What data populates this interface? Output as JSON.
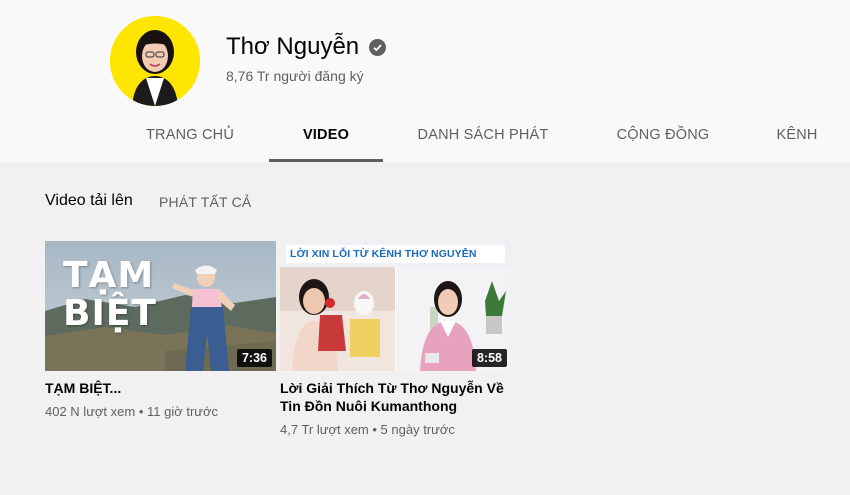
{
  "channel": {
    "name": "Thơ Nguyễn",
    "subscribers": "8,76 Tr người đăng ký"
  },
  "tabs": [
    "TRANG CHỦ",
    "VIDEO",
    "DANH SÁCH PHÁT",
    "CỘNG ĐỒNG",
    "KÊNH"
  ],
  "active_tab": "VIDEO",
  "section": {
    "title": "Video tải lên",
    "play_all": "PHÁT TẤT CẢ"
  },
  "videos": [
    {
      "thumb_text_1": "TẠM",
      "thumb_text_2": "BIỆT",
      "duration": "7:36",
      "title": "TẠM BIỆT...",
      "views": "402 N lượt xem",
      "age": "11 giờ trước"
    },
    {
      "thumb_banner": "LỜI XIN LỖI TỪ KÊNH THƠ NGUYỄN",
      "duration": "8:58",
      "title": "Lời Giải Thích Từ Thơ Nguyễn Về Tin Đồn Nuôi Kumanthong",
      "views": "4,7 Tr lượt xem",
      "age": "5 ngày trước"
    }
  ],
  "colors": {
    "avatar_bg": "#ffe600",
    "header_bg": "#f9f9f9",
    "page_bg": "#f1f1f1",
    "secondary_text": "#606060"
  },
  "icons": [
    "verified-check-icon"
  ]
}
